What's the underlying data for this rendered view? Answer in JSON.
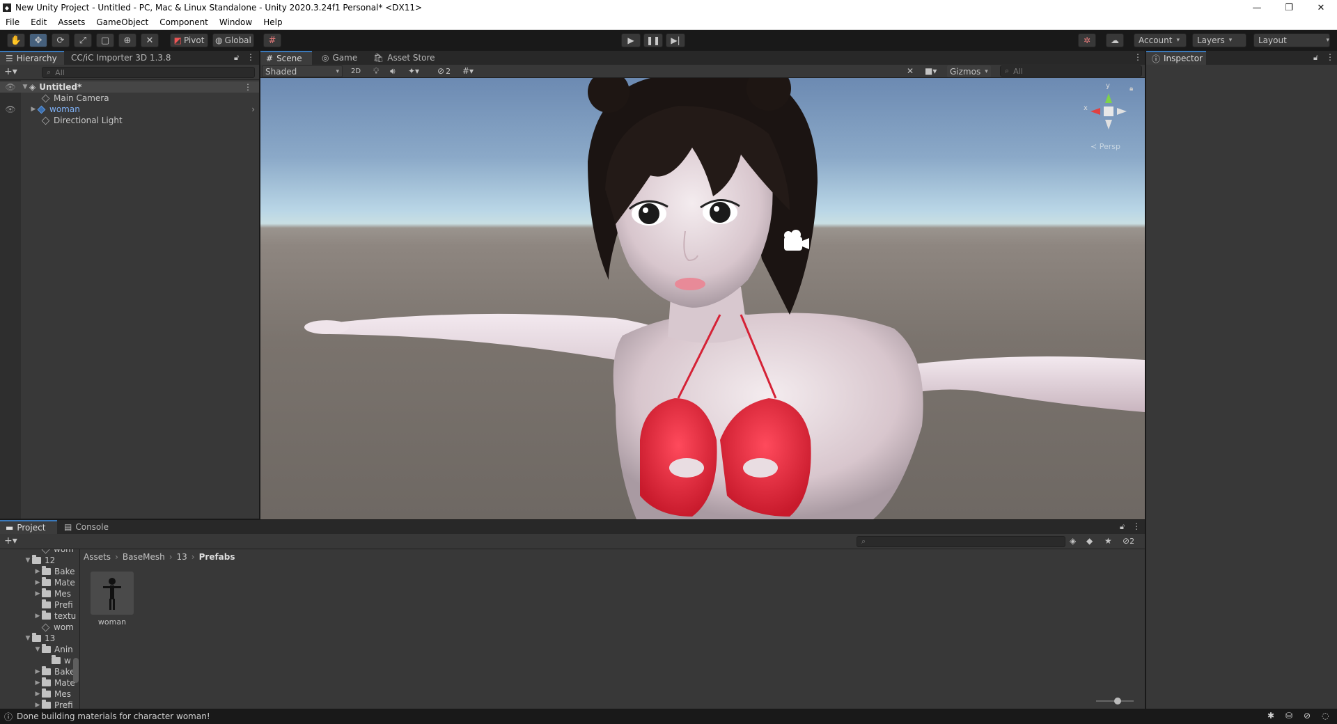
{
  "window": {
    "title": "New Unity Project - Untitled - PC, Mac & Linux Standalone - Unity 2020.3.24f1 Personal* <DX11>",
    "controls": [
      "minimize",
      "restore",
      "close"
    ]
  },
  "menu": [
    "File",
    "Edit",
    "Assets",
    "GameObject",
    "Component",
    "Window",
    "Help"
  ],
  "toolbar": {
    "tools": [
      "hand-tool",
      "move-tool",
      "rotate-tool",
      "scale-tool",
      "rect-tool",
      "transform-tool",
      "custom-tool"
    ],
    "pivot_label": "Pivot",
    "global_label": "Global",
    "account_label": "Account",
    "layers_label": "Layers",
    "layout_label": "Layout"
  },
  "hierarchy": {
    "tab_label": "Hierarchy",
    "importer_tab_label": "CC/iC Importer 3D 1.3.8",
    "search_placeholder": "All",
    "scene_name": "Untitled*",
    "items": [
      {
        "label": "Main Camera",
        "icon": "cube-icon"
      },
      {
        "label": "woman",
        "icon": "prefab-icon"
      },
      {
        "label": "Directional Light",
        "icon": "cube-icon"
      }
    ]
  },
  "scene": {
    "tabs": [
      "Scene",
      "Game",
      "Asset Store"
    ],
    "shading_mode": "Shaded",
    "mode_2d": "2D",
    "hidden_count": "2",
    "gizmos_label": "Gizmos",
    "search_placeholder": "All",
    "persp_label": "Persp",
    "axis_x": "x",
    "axis_y": "y"
  },
  "inspector": {
    "tab_label": "Inspector"
  },
  "project": {
    "tabs": [
      "Project",
      "Console"
    ],
    "hidden_count": "2",
    "breadcrumb": [
      "Assets",
      "BaseMesh",
      "13",
      "Prefabs"
    ],
    "tree": [
      {
        "label": "wom",
        "depth": 2,
        "folder": false,
        "arrow": ""
      },
      {
        "label": "12",
        "depth": 1,
        "folder": true,
        "arrow": "▼"
      },
      {
        "label": "Bake",
        "depth": 2,
        "folder": true,
        "arrow": "▶"
      },
      {
        "label": "Mate",
        "depth": 2,
        "folder": true,
        "arrow": "▶"
      },
      {
        "label": "Mes",
        "depth": 2,
        "folder": true,
        "arrow": "▶"
      },
      {
        "label": "Prefi",
        "depth": 2,
        "folder": true,
        "arrow": ""
      },
      {
        "label": "textu",
        "depth": 2,
        "folder": true,
        "arrow": "▶"
      },
      {
        "label": "wom",
        "depth": 2,
        "folder": false,
        "arrow": ""
      },
      {
        "label": "13",
        "depth": 1,
        "folder": true,
        "arrow": "▼"
      },
      {
        "label": "Anin",
        "depth": 2,
        "folder": true,
        "arrow": "▼"
      },
      {
        "label": "w",
        "depth": 3,
        "folder": true,
        "arrow": ""
      },
      {
        "label": "Bake",
        "depth": 2,
        "folder": true,
        "arrow": "▶"
      },
      {
        "label": "Mate",
        "depth": 2,
        "folder": true,
        "arrow": "▶"
      },
      {
        "label": "Mes",
        "depth": 2,
        "folder": true,
        "arrow": "▶"
      },
      {
        "label": "Prefi",
        "depth": 2,
        "folder": true,
        "arrow": "▶"
      }
    ],
    "assets": [
      {
        "label": "woman"
      }
    ]
  },
  "status": {
    "message": "Done building materials for character woman!"
  }
}
